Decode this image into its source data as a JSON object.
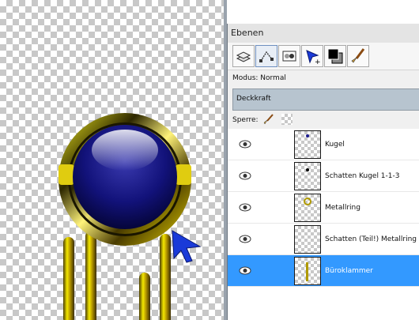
{
  "panel": {
    "title": "Ebenen",
    "mode_label": "Modus: Normal",
    "opacity_label": "Deckkraft",
    "lock_label": "Sperre:"
  },
  "toolbar": {
    "icons": [
      "layers-icon",
      "vector-path-icon",
      "mask-icon",
      "cursor-plus-icon",
      "color-swatch-icon",
      "brush-icon"
    ]
  },
  "layers": [
    {
      "name": "Kugel",
      "selected": false
    },
    {
      "name": "Schatten Kugel 1-1-3",
      "selected": false
    },
    {
      "name": "Metallring",
      "selected": false
    },
    {
      "name": "Schatten (Teil!) Metallring",
      "selected": false
    },
    {
      "name": "Büroklammer",
      "selected": true
    }
  ],
  "colors": {
    "selection": "#3399ff",
    "gold": "#d8c400",
    "sphere": "#0c0c6e"
  }
}
